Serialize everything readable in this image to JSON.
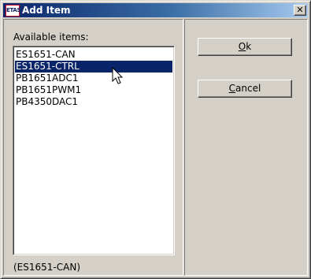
{
  "window": {
    "logo_text": "ETAS",
    "title": "Add Item",
    "close_glyph": "✕"
  },
  "list": {
    "label": "Available items:",
    "items": [
      "ES1651-CAN",
      "ES1651-CTRL",
      "PB1651ADC1",
      "PB1651PWM1",
      "PB4350DAC1"
    ],
    "selected_index": 1
  },
  "status_text": "(ES1651-CAN)",
  "buttons": {
    "ok": {
      "mnemonic": "O",
      "rest": "k"
    },
    "cancel": {
      "mnemonic": "C",
      "rest": "ancel"
    }
  },
  "colors": {
    "face": "#d4d0c8",
    "selection": "#0a246a",
    "titlebar_start": "#0a246a",
    "titlebar_end": "#a6caf0"
  },
  "cursor": "arrow-pointer-icon"
}
